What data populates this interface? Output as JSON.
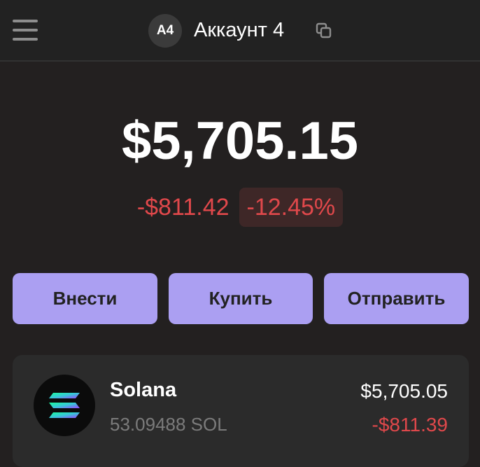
{
  "header": {
    "menu_icon": "hamburger-menu-icon",
    "account_badge": "A4",
    "account_name": "Аккаунт 4",
    "copy_icon": "copy-icon"
  },
  "portfolio": {
    "balance": "$5,705.15",
    "change_amount": "-$811.42",
    "change_percent": "-12.45%"
  },
  "actions": {
    "deposit_label": "Внести",
    "buy_label": "Купить",
    "send_label": "Отправить"
  },
  "tokens": [
    {
      "name": "Solana",
      "amount": "53.09488 SOL",
      "value": "$5,705.05",
      "change": "-$811.39",
      "icon": "solana-logo-icon"
    }
  ],
  "colors": {
    "background": "#232020",
    "header": "#222222",
    "accent": "#ab9ff2",
    "negative": "#e0484b",
    "negative_badge_bg": "#3e2727",
    "card": "#2b2b2b"
  }
}
